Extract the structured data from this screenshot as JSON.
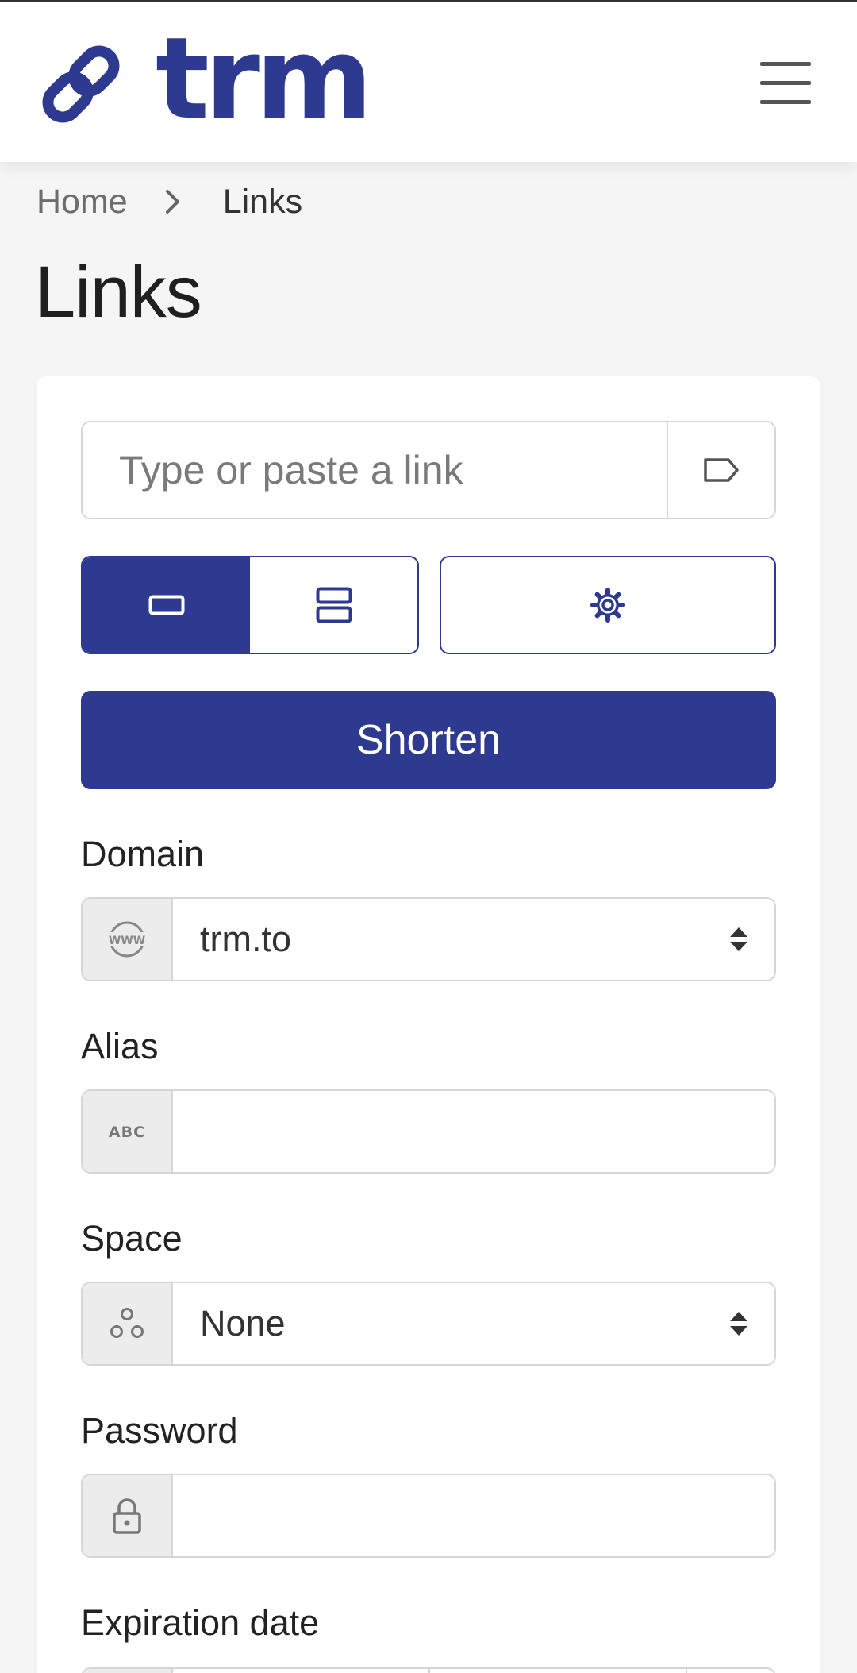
{
  "header": {
    "logo_text": "trm",
    "brand_color": "#2e3a8f",
    "menu_icon": "hamburger-menu-icon"
  },
  "breadcrumb": {
    "home": "Home",
    "current": "Links"
  },
  "page": {
    "title": "Links"
  },
  "form": {
    "link_placeholder": "Type or paste a link",
    "tag_icon": "tag-icon",
    "view_modes": [
      "single-link-icon",
      "multiple-links-icon"
    ],
    "active_view": "single",
    "settings_icon": "gear-icon",
    "shorten_label": "Shorten",
    "domain": {
      "label": "Domain",
      "value": "trm.to",
      "icon": "www-globe-icon"
    },
    "alias": {
      "label": "Alias",
      "value": "",
      "icon": "abc-icon"
    },
    "space": {
      "label": "Space",
      "value": "None",
      "icon": "space-circles-icon"
    },
    "password": {
      "label": "Password",
      "value": "",
      "icon": "lock-icon"
    },
    "expiration": {
      "label": "Expiration date"
    }
  }
}
